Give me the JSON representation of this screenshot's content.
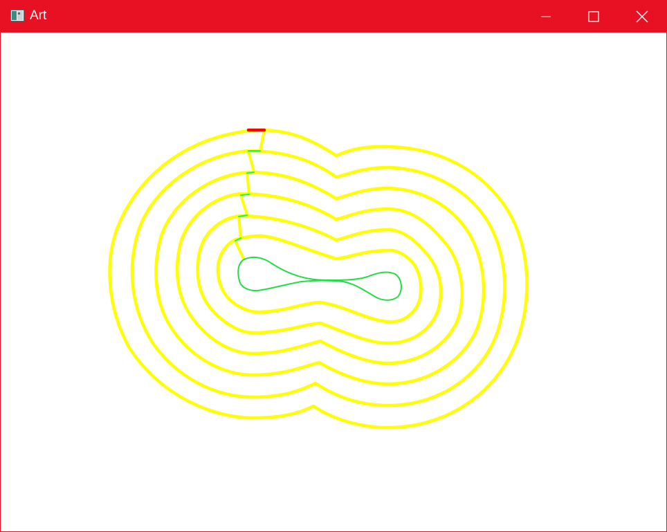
{
  "window": {
    "title": "Art",
    "title_bar_color": "#e81123",
    "app_icon": "window-app-icon",
    "controls": [
      {
        "name": "minimize",
        "icon": "minimize-icon"
      },
      {
        "name": "maximize",
        "icon": "maximize-icon"
      },
      {
        "name": "close",
        "icon": "close-icon"
      }
    ]
  },
  "canvas": {
    "background": "#ffffff",
    "colors": {
      "contour": "#ffff00",
      "contour_edge": "#f2e600",
      "connector": "#00ff66",
      "inner_shape": "#22dd44",
      "start_marker": "#ff0000"
    },
    "description_of_content": ""
  }
}
